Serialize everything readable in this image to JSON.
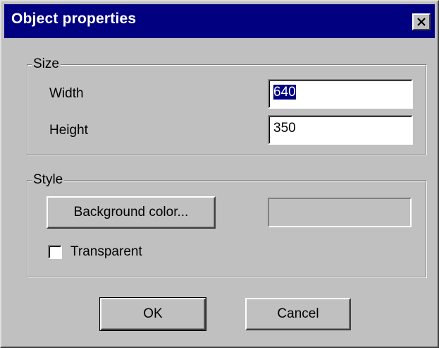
{
  "window": {
    "title": "Object properties",
    "close_icon": "close-icon"
  },
  "size_group": {
    "legend": "Size",
    "width_label": "Width",
    "width_value": "640",
    "height_label": "Height",
    "height_value": "350"
  },
  "style_group": {
    "legend": "Style",
    "background_color_button": "Background color...",
    "transparent_label": "Transparent",
    "transparent_checked": false
  },
  "buttons": {
    "ok": "OK",
    "cancel": "Cancel"
  },
  "colors": {
    "titlebar": "#000080",
    "dialog_face": "#c0c0c0",
    "selection": "#000080"
  }
}
